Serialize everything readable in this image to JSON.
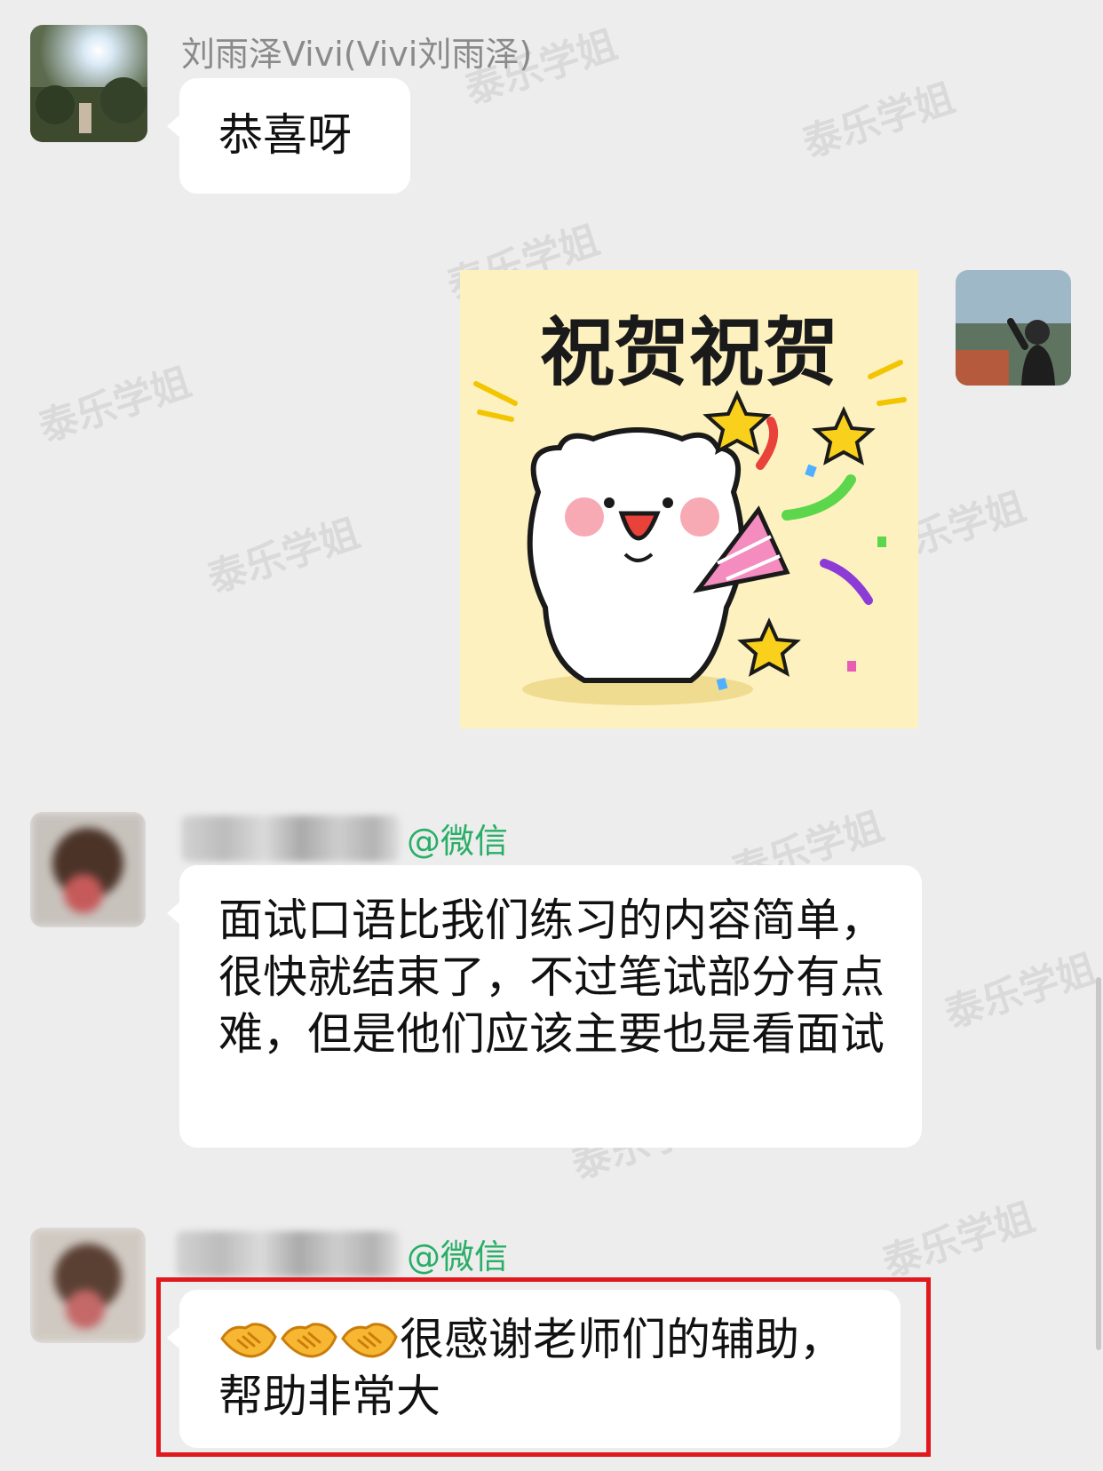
{
  "messages": {
    "m1": {
      "sender": "刘雨泽Vivi(Vivi刘雨泽)",
      "text": "恭喜呀"
    },
    "m3": {
      "tag": "@微信",
      "text": "面试口语比我们练习的内容简单，很快就结束了，不过笔试部分有点难，但是他们应该主要也是看面试"
    },
    "m4": {
      "tag": "@微信",
      "text": "很感谢老师们的辅助，帮助非常大",
      "emoji": "handshake-icon",
      "emoji_count": 3
    }
  },
  "sticker": {
    "text": "祝贺祝贺",
    "icon": "celebrating-bear-sticker"
  },
  "colors": {
    "background": "#ededed",
    "bubble": "#ffffff",
    "wechat_green": "#2aae67",
    "highlight": "#e0191d",
    "sticker_bg": "#fdf1c0"
  },
  "watermarks": [
    "泰乐学姐"
  ]
}
